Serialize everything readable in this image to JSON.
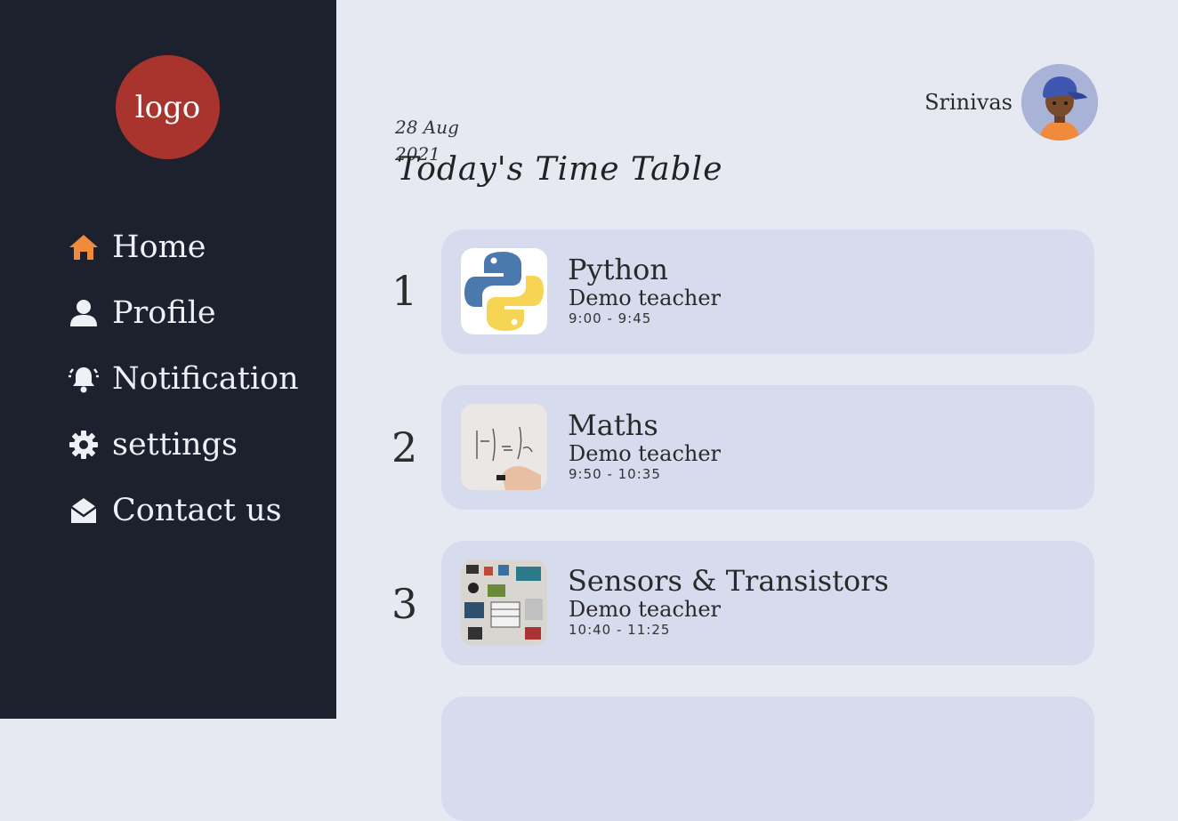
{
  "sidebar": {
    "logo": "logo",
    "items": [
      {
        "label": "Home",
        "icon": "home-icon",
        "color": "#f08a3c"
      },
      {
        "label": "Profile",
        "icon": "user-icon"
      },
      {
        "label": "Notification",
        "icon": "bell-icon"
      },
      {
        "label": "settings",
        "icon": "gear-icon"
      },
      {
        "label": "Contact us",
        "icon": "envelope-open-icon"
      }
    ]
  },
  "header": {
    "user_name": "Srinivas",
    "date_line1": "28 Aug",
    "date_line2": "2021",
    "title": "Today's Time Table"
  },
  "schedule": [
    {
      "index": "1",
      "subject": "Python",
      "teacher": "Demo teacher",
      "time": "9:00 - 9:45"
    },
    {
      "index": "2",
      "subject": "Maths",
      "teacher": "Demo teacher",
      "time": "9:50 - 10:35"
    },
    {
      "index": "3",
      "subject": "Sensors & Transistors",
      "teacher": "Demo teacher",
      "time": "10:40 - 11:25"
    }
  ],
  "colors": {
    "sidebar_bg": "#1c212d",
    "logo_bg": "#a8342d",
    "page_bg": "#e6e9f2",
    "card_bg": "#d7dbee",
    "home_accent": "#f08a3c"
  }
}
